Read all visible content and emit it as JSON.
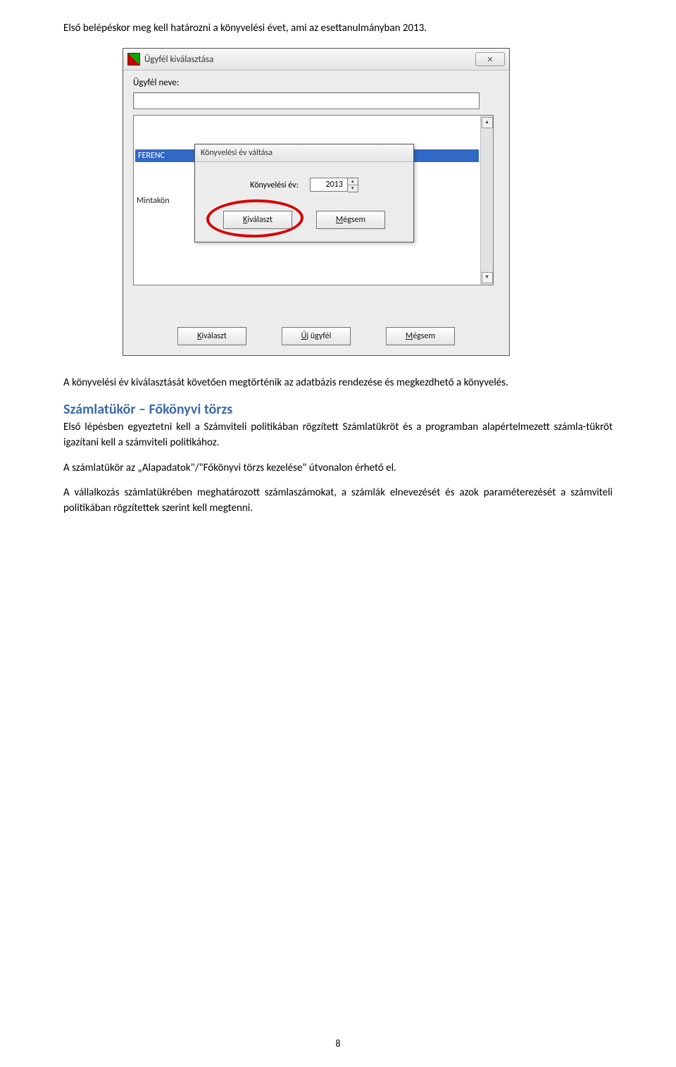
{
  "intro": "Első belépéskor meg kell határozni a könyvelési évet, ami az esettanulmányban 2013.",
  "outer_dialog": {
    "title": "Ügyfél kiválasztása",
    "name_label": "Ügyfél neve:",
    "list_selected": "FERENC",
    "list_other": "Mintakön",
    "close_glyph": "✕",
    "scroll_up": "▴",
    "scroll_down": "▾",
    "buttons": {
      "kivalaszt_pre": "K",
      "kivalaszt_rest": "iválaszt",
      "uj_pre": "Ú",
      "uj_rest": "j ügyfél",
      "megsem_pre": "M",
      "megsem_rest": "égsem"
    }
  },
  "inner_dialog": {
    "title": "Könyvelési év váltása",
    "year_label": "Könyvelési év:",
    "year_value": "2013",
    "spin_up": "▴",
    "spin_down": "▾",
    "buttons": {
      "kivalaszt_pre": "K",
      "kivalaszt_rest": "iválaszt",
      "megsem_pre": "M",
      "megsem_rest": "égsem"
    }
  },
  "para_after": "A könyvelési év kiválasztását követően megtörténik az adatbázis rendezése és megkezdhető a könyvelés.",
  "section_title": "Számlatükör – Főkönyvi törzs",
  "section_p1": "Első lépésben egyeztetni kell a Számviteli politikában rögzített Számlatükröt és a programban alapértelmezett számla-tükröt igazítani kell a számviteli politikához.",
  "section_p2": "A számlatükör az „Alapadatok\"/\"Főkönyvi törzs kezelése\" útvonalon érhető el.",
  "section_p3": "A vállalkozás számlatükrében meghatározott számlaszámokat, a számlák elnevezését és azok paraméterezését a számviteli politikában rögzítettek szerint kell megtenni.",
  "page_number": "8"
}
